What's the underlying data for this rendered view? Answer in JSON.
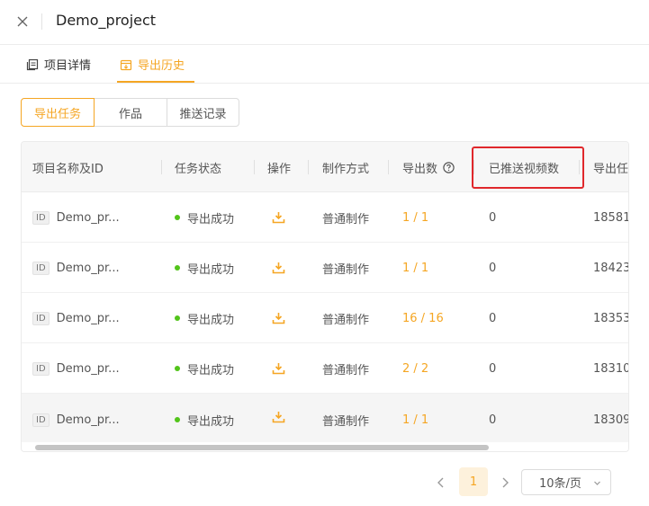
{
  "header": {
    "title": "Demo_project"
  },
  "tabs": [
    {
      "label": "项目详情"
    },
    {
      "label": "导出历史"
    }
  ],
  "segments": [
    {
      "label": "导出任务"
    },
    {
      "label": "作品"
    },
    {
      "label": "推送记录"
    }
  ],
  "table": {
    "columns": [
      "项目名称及ID",
      "任务状态",
      "操作",
      "制作方式",
      "导出数",
      "已推送视频数",
      "导出任"
    ],
    "id_badge": "ID",
    "rows": [
      {
        "name": "Demo_pr...",
        "status": "导出成功",
        "method": "普通制作",
        "export_count": "1 / 1",
        "pushed": "0",
        "task_id": "18581"
      },
      {
        "name": "Demo_pr...",
        "status": "导出成功",
        "method": "普通制作",
        "export_count": "1 / 1",
        "pushed": "0",
        "task_id": "18423"
      },
      {
        "name": "Demo_pr...",
        "status": "导出成功",
        "method": "普通制作",
        "export_count": "16 / 16",
        "pushed": "0",
        "task_id": "18353"
      },
      {
        "name": "Demo_pr...",
        "status": "导出成功",
        "method": "普通制作",
        "export_count": "2 / 2",
        "pushed": "0",
        "task_id": "18310"
      },
      {
        "name": "Demo_pr...",
        "status": "导出成功",
        "method": "普通制作",
        "export_count": "1 / 1",
        "pushed": "0",
        "task_id": "18309"
      }
    ]
  },
  "pagination": {
    "current_page": "1",
    "page_size": "10条/页"
  },
  "colors": {
    "accent": "#f5a623",
    "success": "#52c41a",
    "highlight_border": "#e0282c"
  }
}
